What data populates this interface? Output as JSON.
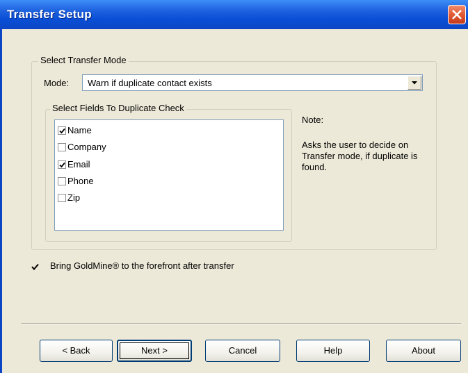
{
  "window": {
    "title": "Transfer Setup"
  },
  "mode_group": {
    "legend": "Select Transfer Mode",
    "mode_label": "Mode:",
    "mode_value": "Warn if duplicate contact exists"
  },
  "fields_group": {
    "legend": "Select Fields To Duplicate Check",
    "fields": [
      {
        "label": "Name",
        "checked": true
      },
      {
        "label": "Company",
        "checked": false
      },
      {
        "label": "Email",
        "checked": true
      },
      {
        "label": "Phone",
        "checked": false
      },
      {
        "label": "Zip",
        "checked": false
      }
    ]
  },
  "note": {
    "title": "Note:",
    "text": "Asks the user to decide on Transfer mode, if duplicate is found."
  },
  "bring_to_front": {
    "label": "Bring GoldMine® to the forefront after transfer",
    "checked": true
  },
  "buttons": {
    "back": "< Back",
    "next": "Next >",
    "cancel": "Cancel",
    "help": "Help",
    "about": "About"
  },
  "colors": {
    "titlebar": "#0a4fd6",
    "close": "#e35a35",
    "dialog_bg": "#ece9d8"
  }
}
